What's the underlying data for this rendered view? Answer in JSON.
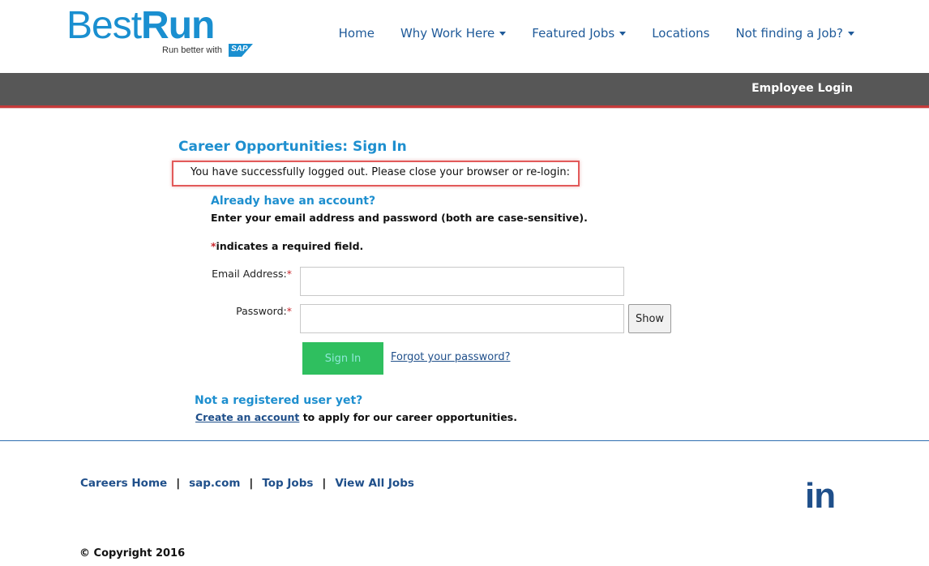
{
  "logo": {
    "best": "Best",
    "run": "Run",
    "tagline": "Run better with",
    "sap": "SAP"
  },
  "nav": {
    "items": [
      {
        "label": "Home",
        "dropdown": false
      },
      {
        "label": "Why Work Here",
        "dropdown": true
      },
      {
        "label": "Featured Jobs",
        "dropdown": true
      },
      {
        "label": "Locations",
        "dropdown": false
      },
      {
        "label": "Not finding a Job?",
        "dropdown": true
      }
    ]
  },
  "bar": {
    "employee_login": "Employee Login"
  },
  "main": {
    "title": "Career Opportunities: Sign In",
    "logout_message": "You have successfully logged out. Please close your browser or re-login:",
    "already_heading": "Already have an account?",
    "enter_instructions": "Enter your email address and password (both are case-sensitive).",
    "required_star": "*",
    "required_text": "indicates a required field.",
    "email_label": "Email Address:",
    "password_label": "Password:",
    "email_value": "",
    "password_value": "",
    "show_label": "Show",
    "signin_label": "Sign In",
    "forgot_label": "Forgot your password?",
    "not_registered": "Not a registered user yet?",
    "create_link": "Create an account",
    "create_rest": " to apply for our career opportunities."
  },
  "footer": {
    "links": [
      "Careers Home",
      "sap.com",
      "Top Jobs",
      "View All Jobs"
    ],
    "separator": "|",
    "linkedin": "in",
    "copyright": "© Copyright 2016"
  },
  "colors": {
    "brand_blue": "#1a8fd0",
    "nav_blue": "#1f5a99",
    "bar_gray": "#575757",
    "accent_red": "#c53a3a",
    "signin_green": "#2fbf5f"
  }
}
